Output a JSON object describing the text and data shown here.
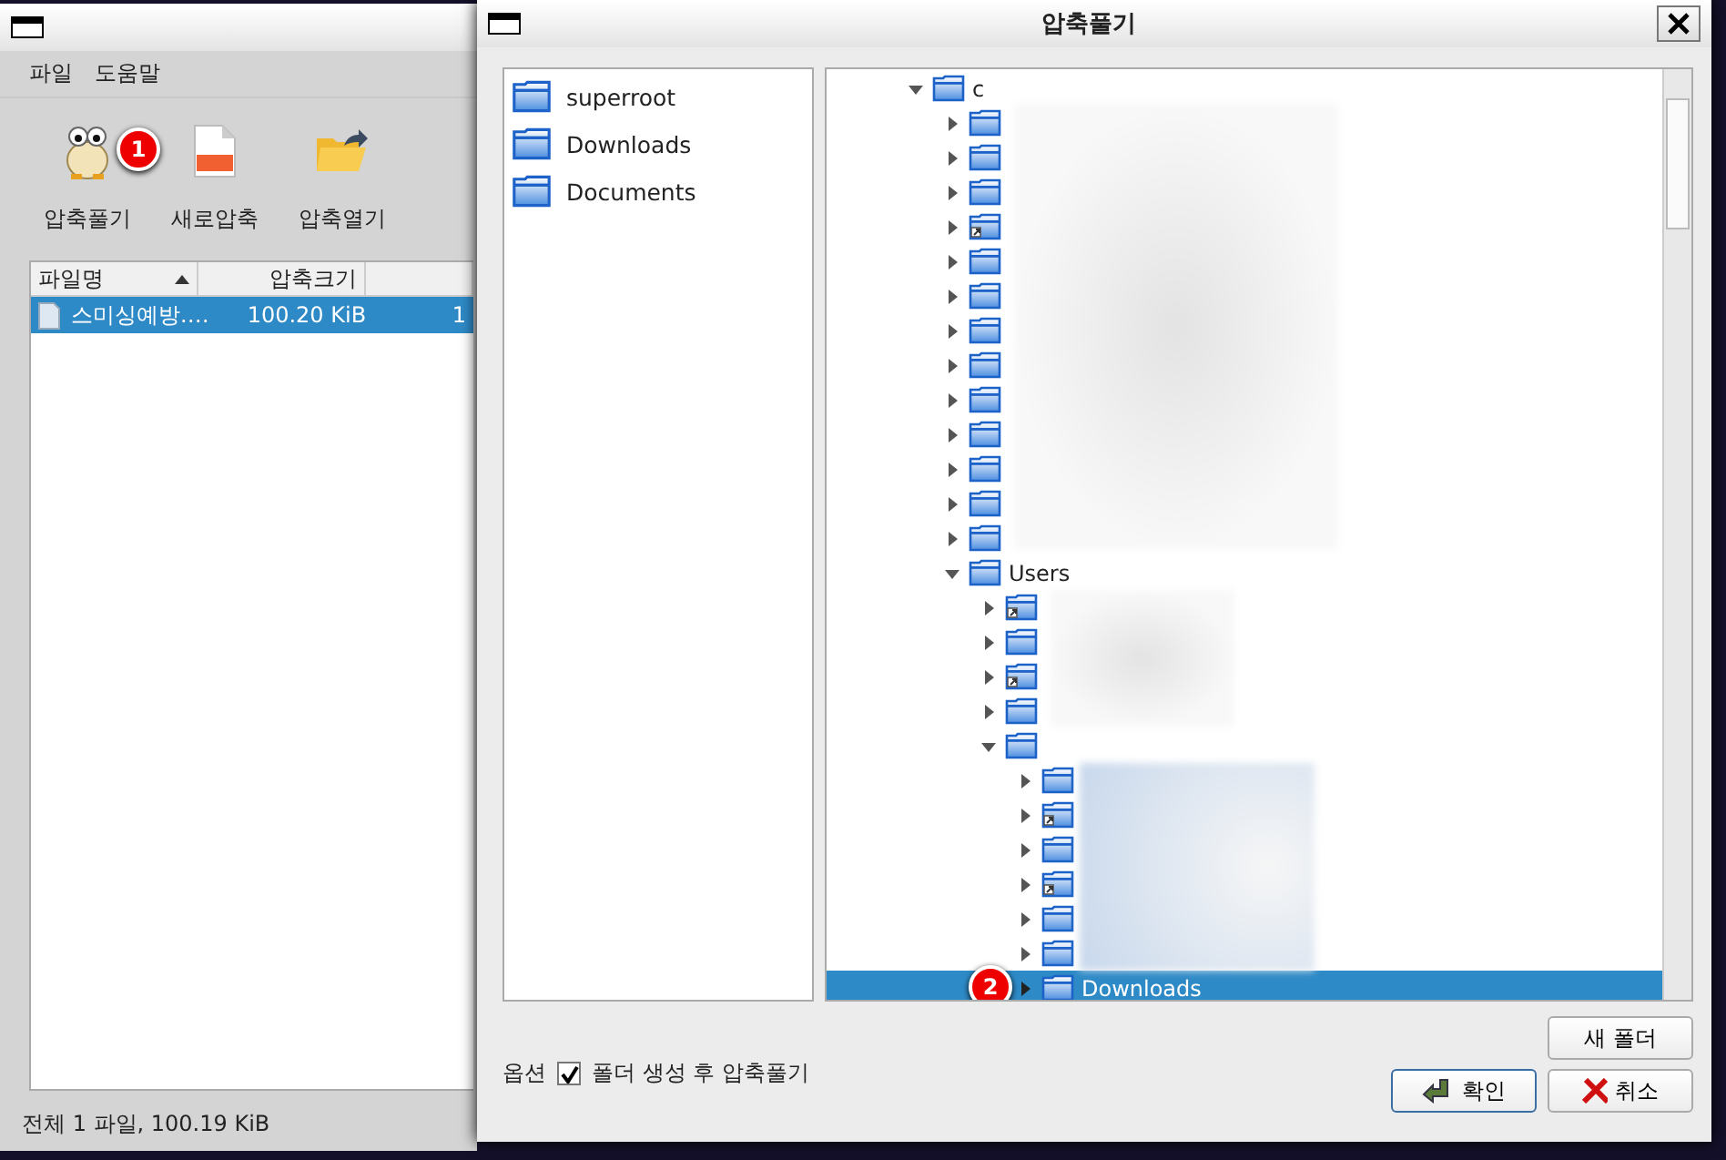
{
  "main_window": {
    "menu": [
      "파일",
      "도움말"
    ],
    "toolbar": [
      {
        "label": "압축풀기",
        "kind": "extract",
        "badge": "1"
      },
      {
        "label": "새로압축",
        "kind": "zip"
      },
      {
        "label": "압축열기",
        "kind": "open"
      }
    ],
    "table": {
      "columns": [
        {
          "label": "파일명",
          "sorted": true
        },
        {
          "label": "압축크기",
          "sorted": false
        },
        {
          "sorted": false
        }
      ],
      "rows": [
        {
          "cells": [
            "스미싱예방.…",
            "100.20 KiB",
            "1"
          ],
          "selected": true
        }
      ]
    },
    "status_bar": "전체 1 파일, 100.19 KiB"
  },
  "dialog": {
    "title": "압축풀기",
    "places": [
      {
        "name": "superroot"
      },
      {
        "name": "Downloads"
      },
      {
        "name": "Documents"
      }
    ],
    "tree": [
      {
        "name": "c",
        "expanded": true,
        "selected": false,
        "children": [
          {
            "expanded": false,
            "selected": false,
            "link": false
          },
          {
            "expanded": false,
            "selected": false,
            "link": false
          },
          {
            "expanded": false,
            "selected": false,
            "link": false
          },
          {
            "expanded": false,
            "selected": false,
            "link": true
          },
          {
            "expanded": false,
            "selected": false,
            "link": false
          },
          {
            "expanded": false,
            "selected": false,
            "link": false
          },
          {
            "expanded": false,
            "selected": false,
            "link": false
          },
          {
            "expanded": false,
            "selected": false,
            "link": false
          },
          {
            "expanded": false,
            "selected": false,
            "link": false
          },
          {
            "expanded": false,
            "selected": false,
            "link": false
          },
          {
            "expanded": false,
            "selected": false,
            "link": false
          },
          {
            "expanded": false,
            "selected": false,
            "link": false
          },
          {
            "expanded": false,
            "selected": false,
            "link": false
          },
          {
            "name": "Users",
            "expanded": true,
            "selected": false,
            "children": [
              {
                "expanded": false,
                "selected": false,
                "link": true
              },
              {
                "expanded": false,
                "selected": false,
                "link": false
              },
              {
                "expanded": false,
                "selected": false,
                "link": true
              },
              {
                "expanded": false,
                "selected": false,
                "link": false
              },
              {
                "expanded": true,
                "selected": false,
                "link": false,
                "children": [
                  {
                    "expanded": false,
                    "selected": false,
                    "link": false
                  },
                  {
                    "expanded": false,
                    "selected": false,
                    "link": true
                  },
                  {
                    "expanded": false,
                    "selected": false,
                    "link": false
                  },
                  {
                    "expanded": false,
                    "selected": false,
                    "link": true
                  },
                  {
                    "expanded": false,
                    "selected": false,
                    "link": false
                  },
                  {
                    "expanded": false,
                    "selected": false,
                    "link": false
                  },
                  {
                    "name": "Downloads",
                    "expanded": false,
                    "selected": true,
                    "link": false,
                    "badge": "2"
                  }
                ]
              }
            ]
          }
        ]
      }
    ],
    "option_label": "옵션",
    "option": {
      "label": "폴더 생성 후 압축풀기",
      "checked": true
    },
    "buttons": [
      {
        "label": "새 폴더",
        "kind": "new-folder"
      },
      {
        "label": "확인",
        "kind": "ok"
      },
      {
        "label": "취소",
        "kind": "cancel"
      }
    ]
  }
}
